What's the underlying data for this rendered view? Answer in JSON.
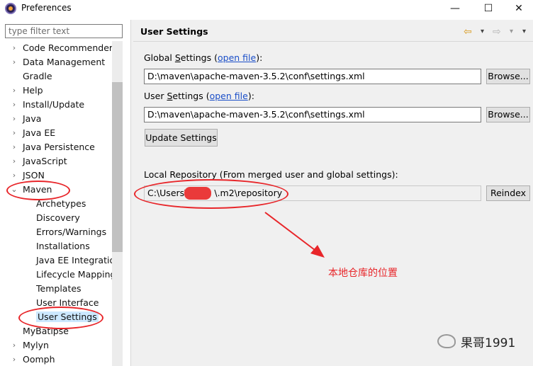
{
  "window": {
    "title": "Preferences",
    "minimize": "—",
    "maximize": "☐",
    "close": "✕"
  },
  "filter": {
    "placeholder": "type filter text"
  },
  "tree": [
    {
      "label": "Code Recommenders",
      "arrow": "›",
      "level": 0
    },
    {
      "label": "Data Management",
      "arrow": "›",
      "level": 0
    },
    {
      "label": "Gradle",
      "arrow": "",
      "level": 0
    },
    {
      "label": "Help",
      "arrow": "›",
      "level": 0
    },
    {
      "label": "Install/Update",
      "arrow": "›",
      "level": 0
    },
    {
      "label": "Java",
      "arrow": "›",
      "level": 0
    },
    {
      "label": "Java EE",
      "arrow": "›",
      "level": 0
    },
    {
      "label": "Java Persistence",
      "arrow": "›",
      "level": 0
    },
    {
      "label": "JavaScript",
      "arrow": "›",
      "level": 0
    },
    {
      "label": "JSON",
      "arrow": "›",
      "level": 0
    },
    {
      "label": "Maven",
      "arrow": "⌄",
      "level": 0
    },
    {
      "label": "Archetypes",
      "arrow": "",
      "level": 1
    },
    {
      "label": "Discovery",
      "arrow": "",
      "level": 1
    },
    {
      "label": "Errors/Warnings",
      "arrow": "",
      "level": 1
    },
    {
      "label": "Installations",
      "arrow": "",
      "level": 1
    },
    {
      "label": "Java EE Integration",
      "arrow": "",
      "level": 1
    },
    {
      "label": "Lifecycle Mapping",
      "arrow": "",
      "level": 1
    },
    {
      "label": "Templates",
      "arrow": "",
      "level": 1
    },
    {
      "label": "User Interface",
      "arrow": "",
      "level": 1
    },
    {
      "label": "User Settings",
      "arrow": "",
      "level": 1,
      "selected": true
    },
    {
      "label": "MyBatipse",
      "arrow": "",
      "level": 0
    },
    {
      "label": "Mylyn",
      "arrow": "›",
      "level": 0
    },
    {
      "label": "Oomph",
      "arrow": "›",
      "level": 0
    }
  ],
  "page": {
    "title": "User Settings",
    "nav_back": "⇦",
    "nav_forward": "⇨",
    "nav_menu": "▾",
    "global_label_pre": "Global ",
    "global_label_accel": "S",
    "global_label_post": "ettings (",
    "global_link": "open file",
    "global_label_end": "):",
    "global_value": "D:\\maven\\apache-maven-3.5.2\\conf\\settings.xml",
    "browse1": "Browse...",
    "user_label_pre": "User ",
    "user_label_accel": "S",
    "user_label_post": "ettings (",
    "user_link": "open file",
    "user_label_end": "):",
    "user_value": "D:\\maven\\apache-maven-3.5.2\\conf\\settings.xml",
    "browse2": "Browse...",
    "update_button": "Update Settings",
    "local_label": "Local Repository (From merged user and global settings):",
    "local_value_a": "C:\\Users\\",
    "local_value_b": "\\.m2\\repository",
    "reindex": "Reindex"
  },
  "annotation": {
    "note": "本地仓库的位置",
    "color": "#e8262a"
  },
  "watermark": {
    "text": "果哥1991"
  }
}
